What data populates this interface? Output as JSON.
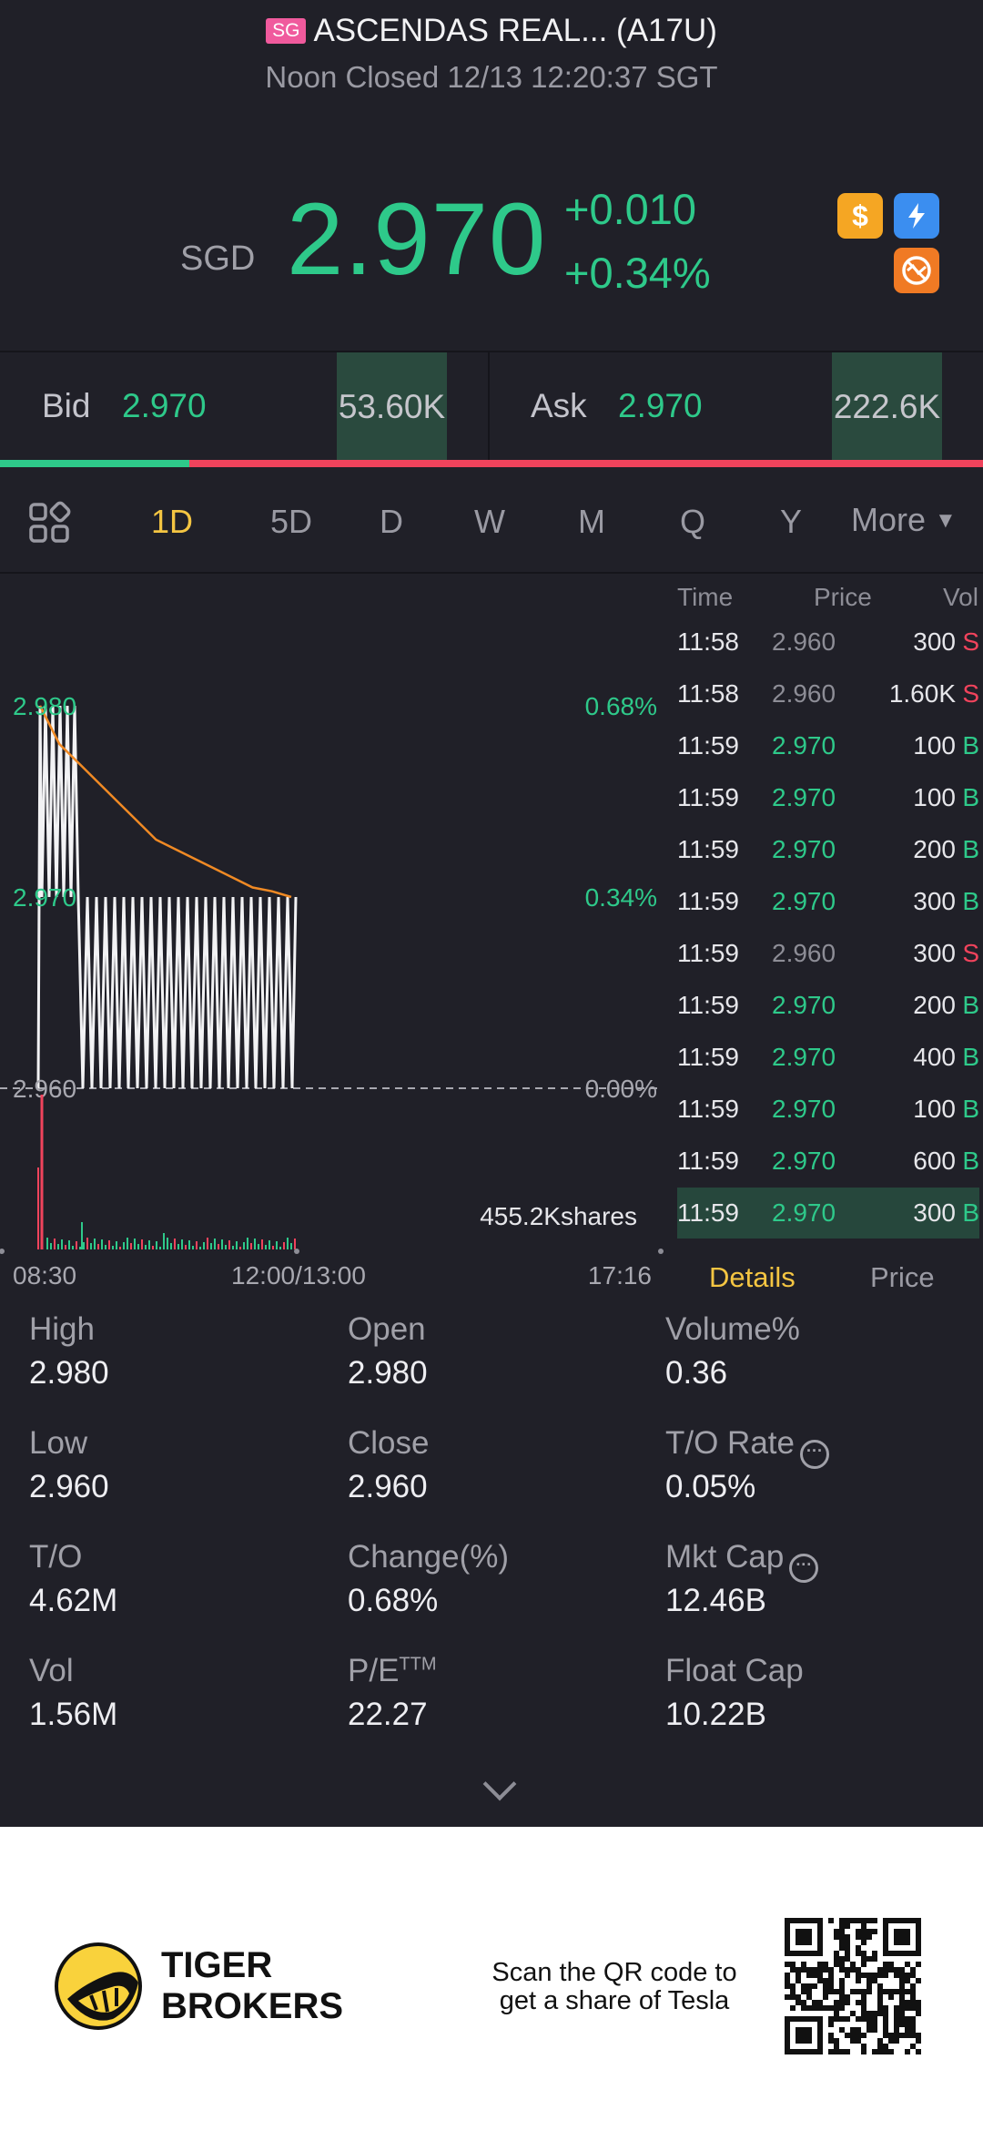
{
  "header": {
    "market_badge": "SG",
    "title": "ASCENDAS REAL... (A17U)",
    "status": "Noon Closed 12/13 12:20:37 SGT"
  },
  "quote": {
    "currency": "SGD",
    "price": "2.970",
    "change": "+0.010",
    "change_pct": "+0.34%",
    "icons": [
      "dollar-badge-icon",
      "lightning-badge-icon",
      "no-short-badge-icon"
    ]
  },
  "bidask": {
    "bid_label": "Bid",
    "bid_price": "2.970",
    "bid_size": "53.60K",
    "ask_label": "Ask",
    "ask_price": "2.970",
    "ask_size": "222.6K",
    "bid_ratio": 0.193
  },
  "tabs": {
    "items": [
      "1D",
      "5D",
      "D",
      "W",
      "M",
      "Q",
      "Y"
    ],
    "active": "1D",
    "more": "More"
  },
  "chart_data": {
    "type": "line",
    "x_ticks": [
      "08:30",
      "12:00/13:00",
      "17:16"
    ],
    "y_ticks": [
      "2.980",
      "2.970",
      "2.960"
    ],
    "y_pct_ticks": [
      "0.68%",
      "0.34%",
      "0.00%"
    ],
    "ylim": [
      2.96,
      2.98
    ],
    "volume_label": "455.2Kshares",
    "avg_price_line": [
      2.98,
      2.978,
      2.977,
      2.976,
      2.975,
      2.974,
      2.973,
      2.9725,
      2.972,
      2.9715,
      2.971,
      2.9705,
      2.9703,
      2.97
    ],
    "colors": {
      "price": "#f2f2f4",
      "average": "#f08a24",
      "up": "#2ec98a",
      "down": "#f0435c"
    }
  },
  "trades": {
    "headers": [
      "Time",
      "Price",
      "Vol"
    ],
    "rows": [
      {
        "time": "11:58",
        "price": "2.960",
        "vol": "300",
        "side": "S"
      },
      {
        "time": "11:58",
        "price": "2.960",
        "vol": "1.60K",
        "side": "S"
      },
      {
        "time": "11:59",
        "price": "2.970",
        "vol": "100",
        "side": "B"
      },
      {
        "time": "11:59",
        "price": "2.970",
        "vol": "100",
        "side": "B"
      },
      {
        "time": "11:59",
        "price": "2.970",
        "vol": "200",
        "side": "B"
      },
      {
        "time": "11:59",
        "price": "2.970",
        "vol": "300",
        "side": "B"
      },
      {
        "time": "11:59",
        "price": "2.960",
        "vol": "300",
        "side": "S"
      },
      {
        "time": "11:59",
        "price": "2.970",
        "vol": "200",
        "side": "B"
      },
      {
        "time": "11:59",
        "price": "2.970",
        "vol": "400",
        "side": "B"
      },
      {
        "time": "11:59",
        "price": "2.970",
        "vol": "100",
        "side": "B"
      },
      {
        "time": "11:59",
        "price": "2.970",
        "vol": "600",
        "side": "B"
      },
      {
        "time": "11:59",
        "price": "2.970",
        "vol": "300",
        "side": "B"
      }
    ],
    "tab_details": "Details",
    "tab_price": "Price"
  },
  "stats": [
    {
      "label": "High",
      "value": "2.980"
    },
    {
      "label": "Open",
      "value": "2.980"
    },
    {
      "label": "Volume%",
      "value": "0.36"
    },
    {
      "label": "Low",
      "value": "2.960"
    },
    {
      "label": "Close",
      "value": "2.960"
    },
    {
      "label": "T/O Rate",
      "value": "0.05%"
    },
    {
      "label": "T/O",
      "value": "4.62M"
    },
    {
      "label": "Change(%)",
      "value": "0.68%"
    },
    {
      "label": "Mkt Cap",
      "value": "12.46B"
    },
    {
      "label": "Vol",
      "value": "1.56M"
    },
    {
      "label": "P/E",
      "label_sup": "TTM",
      "value": "22.27"
    },
    {
      "label": "Float Cap",
      "value": "10.22B"
    }
  ],
  "footer": {
    "brand_line1": "TIGER",
    "brand_line2": "BROKERS",
    "promo_line1": "Scan the QR code to",
    "promo_line2": "get a share of Tesla"
  }
}
